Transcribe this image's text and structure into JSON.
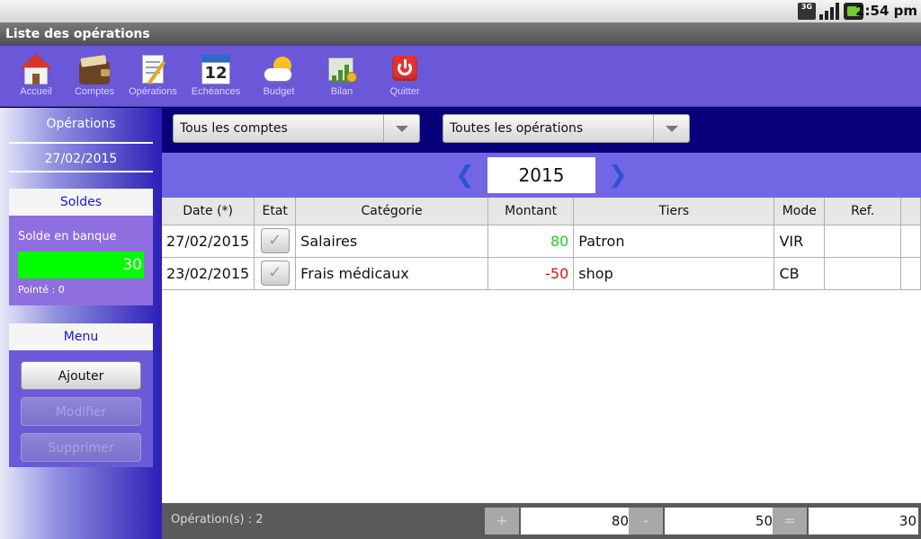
{
  "status_bar": {
    "network": "3G",
    "time": "2:54 pm",
    "icons": [
      "3g-icon",
      "signal-icon",
      "battery-icon"
    ]
  },
  "window": {
    "title": "Liste des opérations"
  },
  "toolbar": {
    "items": [
      {
        "label": "Accueil",
        "icon": "home-icon"
      },
      {
        "label": "Comptes",
        "icon": "wallet-icon"
      },
      {
        "label": "Opérations",
        "icon": "notepad-icon"
      },
      {
        "label": "Echéances",
        "icon": "calendar-icon"
      },
      {
        "label": "Budget",
        "icon": "weather-icon"
      },
      {
        "label": "Bilan",
        "icon": "chart-icon"
      },
      {
        "label": "Quitter",
        "icon": "power-icon"
      }
    ],
    "calendar_day": "12"
  },
  "sidebar": {
    "title": "Opérations",
    "date": "27/02/2015",
    "soldes": {
      "header": "Soldes",
      "label": "Solde en banque",
      "value": "30",
      "pointe": "Pointé : 0",
      "value_color": "#00ff00"
    },
    "menu": {
      "header": "Menu",
      "buttons": [
        {
          "label": "Ajouter",
          "enabled": true
        },
        {
          "label": "Modifier",
          "enabled": false
        },
        {
          "label": "Supprimer",
          "enabled": false
        }
      ]
    }
  },
  "filters": {
    "account": "Tous les comptes",
    "operation_type": "Toutes les opérations"
  },
  "year_nav": {
    "year": "2015",
    "prev_glyph": "❮",
    "next_glyph": "❯"
  },
  "table": {
    "headers": [
      "Date (*)",
      "Etat",
      "Catégorie",
      "Montant",
      "Tiers",
      "Mode",
      "Ref."
    ],
    "rows": [
      {
        "date": "27/02/2015",
        "etat": "✓",
        "categorie": "Salaires",
        "montant": "80",
        "tiers": "Patron",
        "mode": "VIR",
        "ref": ""
      },
      {
        "date": "23/02/2015",
        "etat": "✓",
        "categorie": "Frais médicaux",
        "montant": "-50",
        "tiers": "shop",
        "mode": "CB",
        "ref": ""
      }
    ]
  },
  "footer": {
    "count": "Opération(s) : 2",
    "plus_sign": "+",
    "plus_value": "80",
    "minus_sign": "-",
    "minus_value": "50",
    "equal_sign": "=",
    "total_value": "30"
  },
  "colors": {
    "toolbar_bg": "#6a58d8",
    "filter_bar_bg": "#07007a",
    "positive_amount": "#22cc22",
    "negative_amount": "#dd1111"
  }
}
